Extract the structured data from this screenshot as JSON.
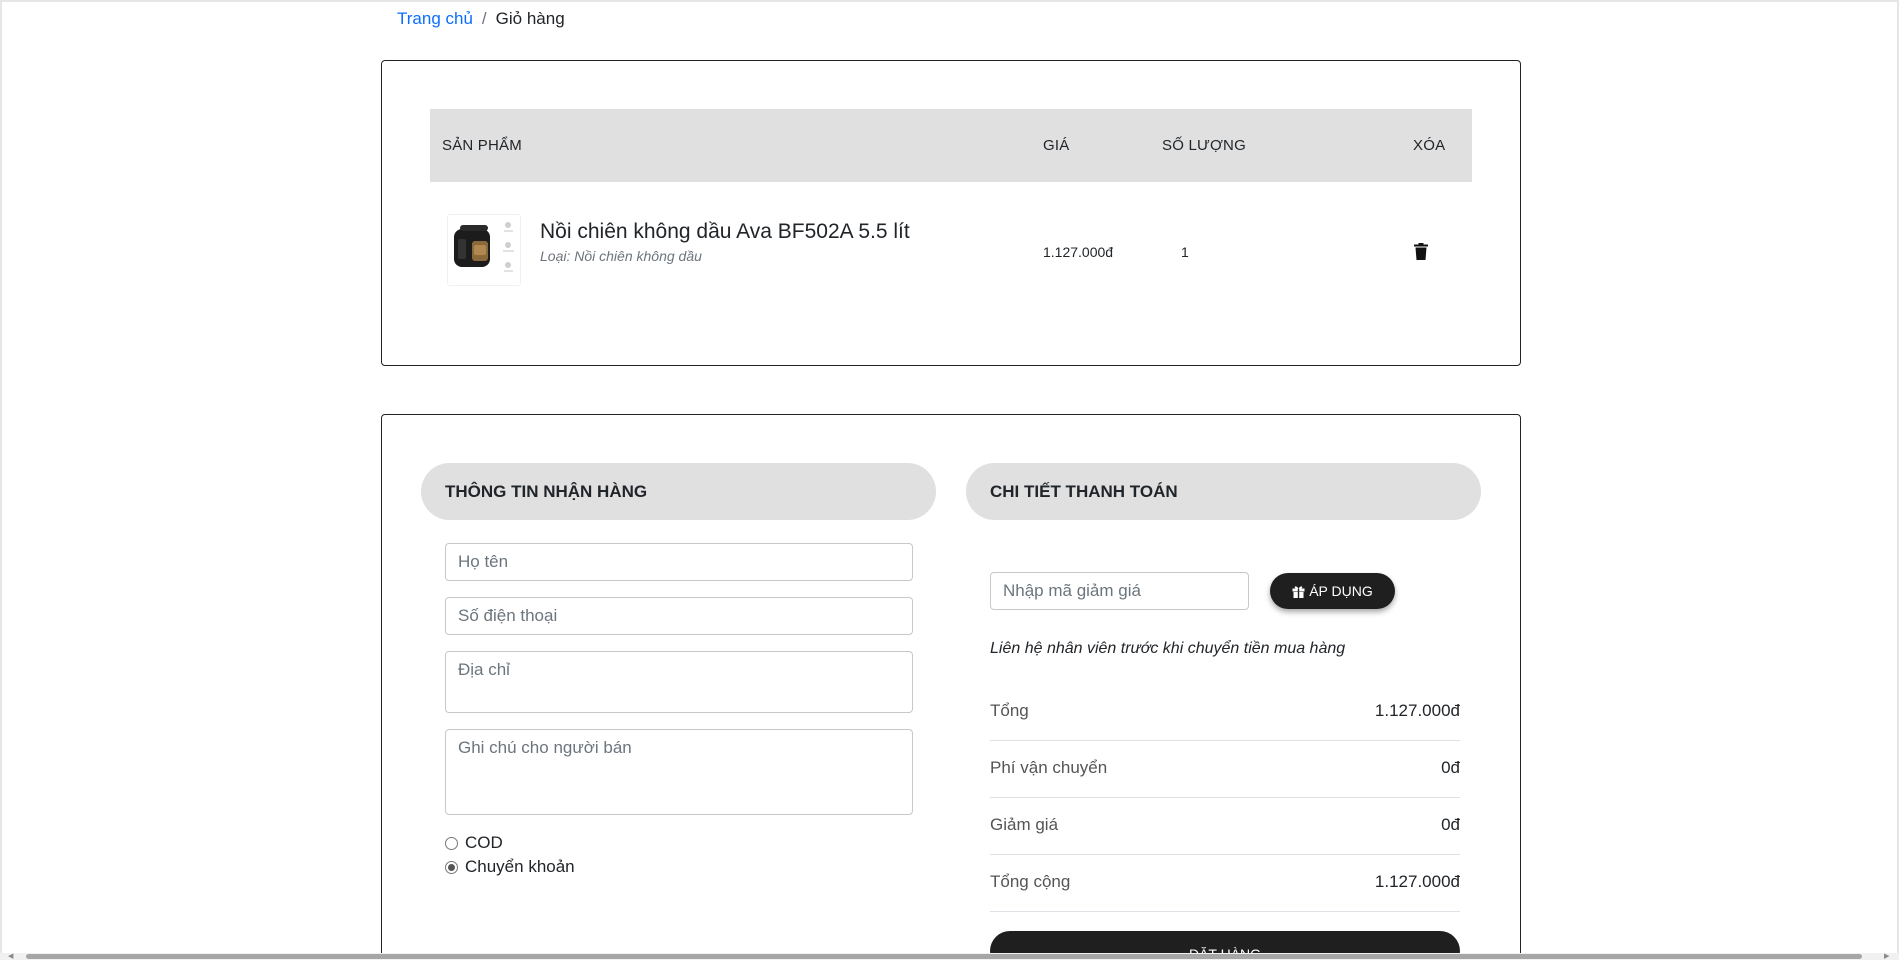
{
  "breadcrumb": {
    "home": "Trang chủ",
    "separator": "/",
    "current": "Giỏ hàng"
  },
  "cart": {
    "headers": {
      "product": "SẢN PHẨM",
      "price": "GIÁ",
      "quantity": "SỐ LƯỢNG",
      "delete": "XÓA"
    },
    "items": [
      {
        "name": "Nồi chiên không dầu Ava BF502A 5.5 lít",
        "type": "Loại: Nồi chiên không dầu",
        "price": "1.127.000đ",
        "quantity": "1",
        "delete_icon": "trash-icon"
      }
    ]
  },
  "shipping": {
    "title": "THÔNG TIN NHẬN HÀNG",
    "name_placeholder": "Họ tên",
    "phone_placeholder": "Số điện thoại",
    "address_placeholder": "Địa chỉ",
    "note_placeholder": "Ghi chú cho người bán",
    "payment_options": [
      {
        "label": "COD",
        "selected": false
      },
      {
        "label": "Chuyển khoản",
        "selected": true
      }
    ]
  },
  "payment": {
    "title": "CHI TIẾT THANH TOÁN",
    "coupon_placeholder": "Nhập mã giảm giá",
    "apply_label": "ÁP DỤNG",
    "apply_icon": "gift-icon",
    "note": "Liên hệ nhân viên trước khi chuyển tiền mua hàng",
    "summary": [
      {
        "label": "Tổng",
        "value": "1.127.000đ"
      },
      {
        "label": "Phí vận chuyển",
        "value": "0đ"
      },
      {
        "label": "Giảm giá",
        "value": "0đ"
      },
      {
        "label": "Tổng cộng",
        "value": "1.127.000đ"
      }
    ],
    "order_label": "ĐẶT HÀNG"
  },
  "colors": {
    "link": "#0d6efd",
    "header_bg": "#e0e0e0",
    "button_bg": "#1f1f1f"
  }
}
